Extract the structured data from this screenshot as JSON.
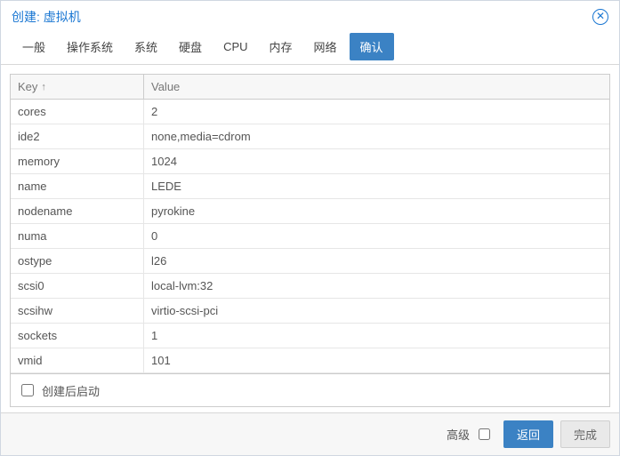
{
  "dialog": {
    "title": "创建: 虚拟机"
  },
  "tabs": {
    "items": [
      "一般",
      "操作系统",
      "系统",
      "硬盘",
      "CPU",
      "内存",
      "网络",
      "确认"
    ],
    "active_index": 7
  },
  "table": {
    "head_key": "Key",
    "head_value": "Value",
    "sort_dir": "asc",
    "rows": [
      {
        "k": "cores",
        "v": "2"
      },
      {
        "k": "ide2",
        "v": "none,media=cdrom"
      },
      {
        "k": "memory",
        "v": "1024"
      },
      {
        "k": "name",
        "v": "LEDE"
      },
      {
        "k": "nodename",
        "v": "pyrokine"
      },
      {
        "k": "numa",
        "v": "0"
      },
      {
        "k": "ostype",
        "v": "l26"
      },
      {
        "k": "scsi0",
        "v": "local-lvm:32"
      },
      {
        "k": "scsihw",
        "v": "virtio-scsi-pci"
      },
      {
        "k": "sockets",
        "v": "1"
      },
      {
        "k": "vmid",
        "v": "101"
      }
    ]
  },
  "footer": {
    "start_after_create_label": "创建后启动",
    "start_after_create_checked": false
  },
  "buttons": {
    "advanced_label": "高级",
    "advanced_checked": false,
    "back": "返回",
    "finish": "完成"
  }
}
